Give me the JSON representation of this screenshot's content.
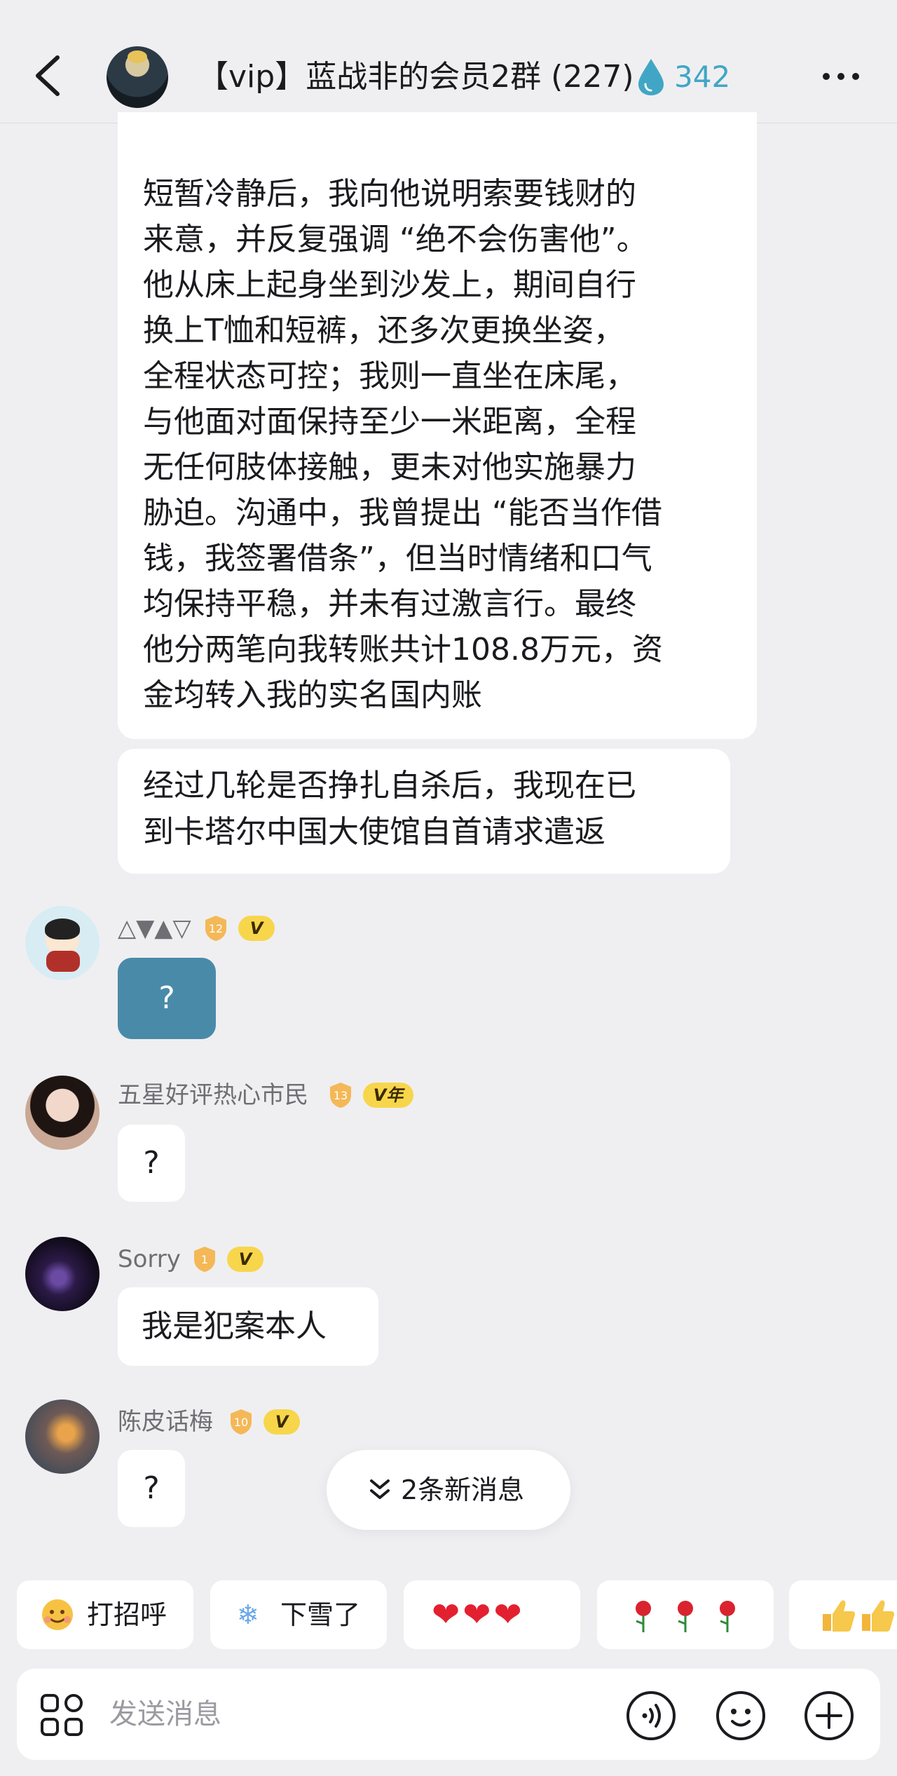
{
  "header": {
    "title": "【vip】蓝战非的会员2群 (227)",
    "drop_count": "342",
    "accent_color": "#41a6c5"
  },
  "messages": {
    "main": "短暂冷静后，我向他说明索要钱财的\n来意，并反复强调 “绝不会伤害他”。\n他从床上起身坐到沙发上，期间自行\n换上T恤和短裤，还多次更换坐姿，\n全程状态可控；我则一直坐在床尾，\n与他面对面保持至少一米距离，全程\n无任何肢体接触，更未对他实施暴力\n胁迫。沟通中，我曾提出 “能否当作借\n钱，我签署借条”，但当时情绪和口气\n均保持平稳，并未有过激言行。最终\n他分两笔向我转账共计108.8万元，资\n金均转入我的实名国内账",
    "second": "经过几轮是否挣扎自杀后，我现在已\n到卡塔尔中国大使馆自首请求遣返"
  },
  "posts": [
    {
      "name": "△▼▲▽",
      "level": "12",
      "vip": "V",
      "text": "?"
    },
    {
      "name": "五星好评热心市民",
      "level": "13",
      "vip": "V年",
      "text": "?"
    },
    {
      "name": "Sorry",
      "level": "1",
      "vip": "V",
      "text": "我是犯案本人"
    },
    {
      "name": "陈皮话梅",
      "level": "10",
      "vip": "V",
      "text": "?"
    }
  ],
  "new_messages": "2条新消息",
  "quick_replies": [
    {
      "label": "打招呼",
      "icon": "wave-emoji-icon"
    },
    {
      "label": "下雪了",
      "icon": "snowflake-icon"
    },
    {
      "label": "",
      "icon": "hearts-icon"
    },
    {
      "label": "",
      "icon": "roses-icon"
    },
    {
      "label": "",
      "icon": "thumbs-up-icon"
    }
  ],
  "input": {
    "placeholder": "发送消息"
  }
}
